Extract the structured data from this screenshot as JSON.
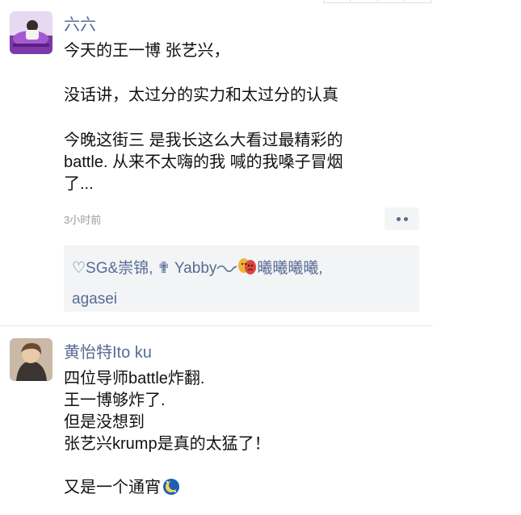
{
  "posts": [
    {
      "author": "六六",
      "lines": [
        "今天的王一博 张艺兴，",
        "",
        "没话讲，太过分的实力和太过分的认真",
        "",
        "今晚这街三 是我长这么大看过最精彩的",
        "battle. 从来不太嗨的我 喊的我嗓子冒烟",
        "了..."
      ],
      "time": "3小时前",
      "likes": {
        "names": [
          "♡SG&崇锦,",
          "✟ Yabby",
          "曦曦曦曦,",
          "agasei"
        ]
      }
    },
    {
      "author": "黄怡特Ito ku",
      "lines": [
        "四位导师battle炸翻.",
        "王一博够炸了.",
        "但是没想到",
        "张艺兴krump是真的太猛了！",
        "",
        "又是一个通宵"
      ]
    }
  ],
  "icons": {
    "more": "more-dots-icon",
    "moon": "crescent-moon-emoji-icon",
    "mask": "theater-mask-emoji-icon"
  },
  "colors": {
    "name_link": "#576b95",
    "text": "#111111",
    "meta": "#9b9b9b",
    "panel_bg": "#f3f4f6"
  }
}
